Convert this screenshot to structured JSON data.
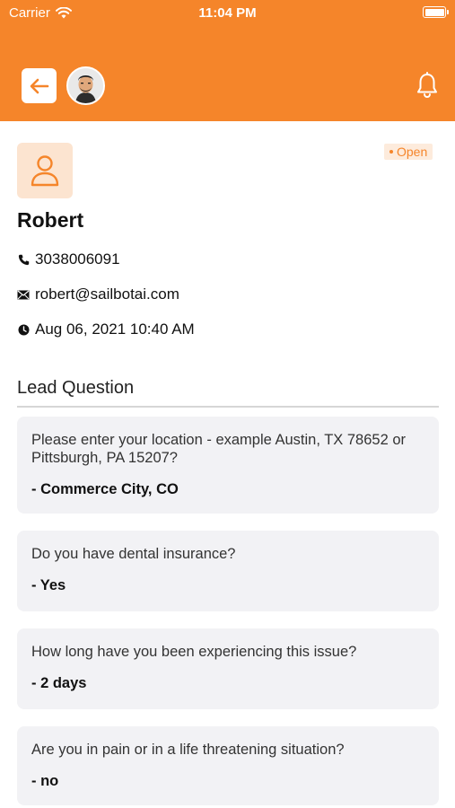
{
  "status_bar": {
    "carrier": "Carrier",
    "time": "11:04 PM"
  },
  "header": {
    "back_icon": "arrow-left-icon",
    "avatar": "user-avatar",
    "bell_icon": "bell-icon"
  },
  "lead": {
    "status": "Open",
    "name": "Robert",
    "phone": "3038006091",
    "email": "robert@sailbotai.com",
    "datetime": "Aug 06, 2021 10:40 AM"
  },
  "section_title": "Lead Question",
  "questions": [
    {
      "question": "Please enter your location - example Austin, TX 78652 or Pittsburgh, PA 15207?",
      "answer": "- Commerce City, CO"
    },
    {
      "question": "Do you have dental insurance?",
      "answer": "- Yes"
    },
    {
      "question": "How long have you been experiencing this issue?",
      "answer": "- 2 days"
    },
    {
      "question": "Are you in pain or in a life threatening situation?",
      "answer": "- no"
    }
  ],
  "colors": {
    "accent": "#F5852A",
    "card_bg": "#F2F2F5",
    "badge_bg": "#FDEBDC"
  }
}
